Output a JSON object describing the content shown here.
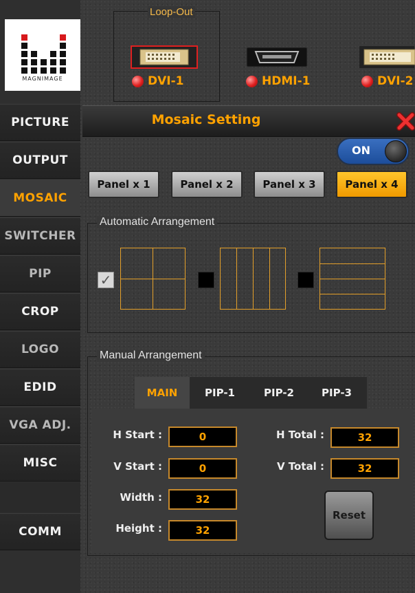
{
  "brand": {
    "logo_text": "MAGNIMAGE"
  },
  "sidebar": {
    "items": [
      {
        "label": "PICTURE",
        "state": "normal"
      },
      {
        "label": "OUTPUT",
        "state": "normal"
      },
      {
        "label": "MOSAIC",
        "state": "active"
      },
      {
        "label": "SWITCHER",
        "state": "dim"
      },
      {
        "label": "PIP",
        "state": "dim"
      },
      {
        "label": "CROP",
        "state": "normal"
      },
      {
        "label": "LOGO",
        "state": "dim"
      },
      {
        "label": "EDID",
        "state": "normal"
      },
      {
        "label": "VGA ADJ.",
        "state": "dim"
      },
      {
        "label": "MISC",
        "state": "normal"
      },
      {
        "label": "COMM",
        "state": "normal"
      }
    ]
  },
  "loop_out": {
    "title": "Loop-Out",
    "ports": [
      {
        "label": "DVI-1",
        "icon": "dvi-connector-icon",
        "selected": true
      },
      {
        "label": "HDMI-1",
        "icon": "hdmi-connector-icon",
        "selected": false
      },
      {
        "label": "DVI-2",
        "icon": "dvi-connector-icon",
        "selected": false
      }
    ]
  },
  "mosaic": {
    "title": "Mosaic Setting",
    "toggle_label": "ON",
    "panel_buttons": [
      "Panel x 1",
      "Panel x 2",
      "Panel x 3",
      "Panel x 4"
    ],
    "selected_panel": "Panel x 4",
    "auto_title": "Automatic Arrangement",
    "auto_options": [
      {
        "layout": "2x2 grid",
        "checked": true
      },
      {
        "layout": "4 columns",
        "checked": false
      },
      {
        "layout": "4 rows",
        "checked": false
      }
    ],
    "manual_title": "Manual Arrangement",
    "tabs": [
      "MAIN",
      "PIP-1",
      "PIP-2",
      "PIP-3"
    ],
    "active_tab": "MAIN",
    "fields": {
      "h_start": {
        "label": "H Start :",
        "value": "0"
      },
      "v_start": {
        "label": "V Start :",
        "value": "0"
      },
      "width": {
        "label": "Width :",
        "value": "32"
      },
      "height": {
        "label": "Height :",
        "value": "32"
      },
      "h_total": {
        "label": "H Total :",
        "value": "32"
      },
      "v_total": {
        "label": "V Total :",
        "value": "32"
      }
    },
    "reset_label": "Reset"
  },
  "colors": {
    "accent": "#ffa200",
    "field_border": "#c7892b",
    "toggle": "#2a5faf",
    "led": "#e02020"
  }
}
